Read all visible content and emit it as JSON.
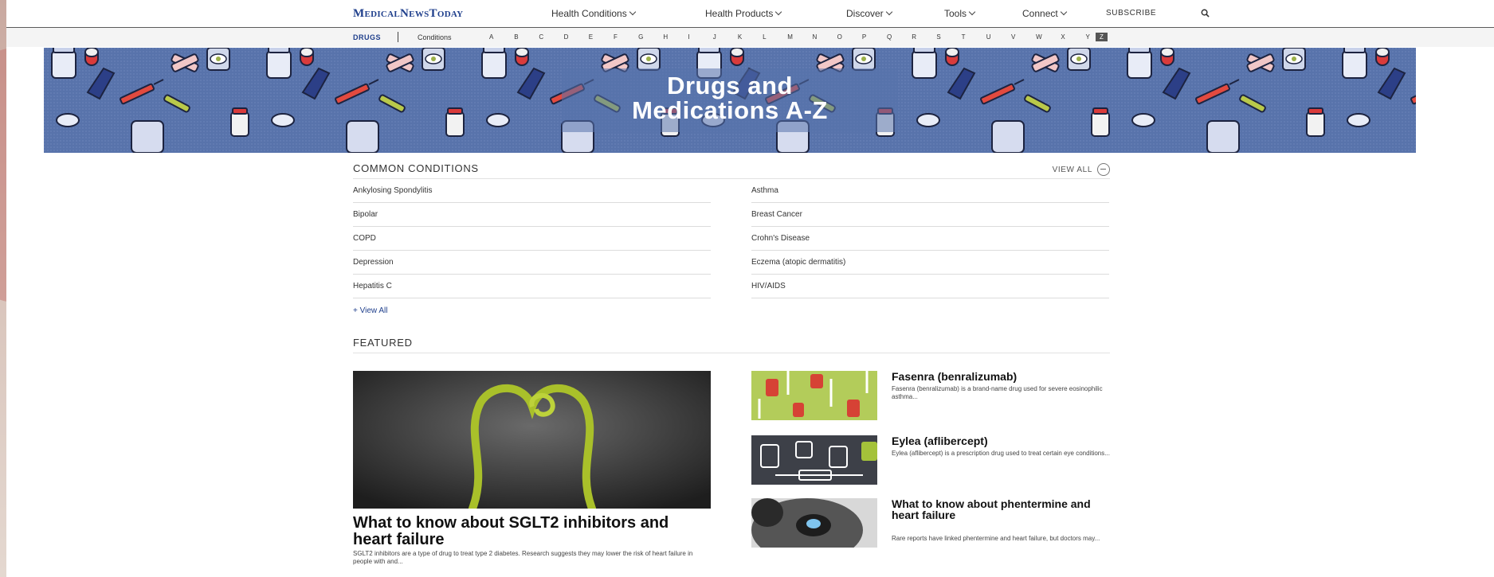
{
  "header": {
    "logo": "MedicalNewsToday",
    "nav": [
      {
        "label": "Health Conditions"
      },
      {
        "label": "Health Products"
      },
      {
        "label": "Discover"
      },
      {
        "label": "Tools"
      },
      {
        "label": "Connect"
      }
    ],
    "subscribe": "SUBSCRIBE"
  },
  "subnav": {
    "drugs": "DRUGS",
    "conditions": "Conditions",
    "letters": [
      "A",
      "B",
      "C",
      "D",
      "E",
      "F",
      "G",
      "H",
      "I",
      "J",
      "K",
      "L",
      "M",
      "N",
      "O",
      "P",
      "Q",
      "R",
      "S",
      "T",
      "U",
      "V",
      "W",
      "X",
      "Y"
    ],
    "next": "Z"
  },
  "hero": {
    "title_line1": "Drugs and",
    "title_line2": "Medications A-Z"
  },
  "common_conditions": {
    "title": "COMMON CONDITIONS",
    "view_all": "VIEW ALL",
    "items": [
      "Ankylosing Spondylitis",
      "Asthma",
      "Bipolar",
      "Breast Cancer",
      "COPD",
      "Crohn's Disease",
      "Depression",
      "Eczema (atopic dermatitis)",
      "Hepatitis C",
      "HIV/AIDS"
    ],
    "view_all_link": "+ View All"
  },
  "featured": {
    "title": "FEATURED",
    "main": {
      "title": "What to know about SGLT2 inhibitors and heart failure",
      "desc": "SGLT2 inhibitors are a type of drug to treat type 2 diabetes. Research suggests they may lower the risk of heart failure in people with and..."
    },
    "side": [
      {
        "title": "Fasenra (benralizumab)",
        "desc": "Fasenra (benralizumab) is a brand-name drug used for severe eosinophilic asthma..."
      },
      {
        "title": "Eylea (aflibercept)",
        "desc": "Eylea (aflibercept) is a prescription drug used to treat certain eye conditions..."
      },
      {
        "title": "What to know about phentermine and heart failure",
        "desc": "Rare reports have linked phentermine and heart failure, but doctors may..."
      }
    ]
  },
  "colors": {
    "brand": "#1f3f8c",
    "hero_bg": "#5873ab"
  }
}
